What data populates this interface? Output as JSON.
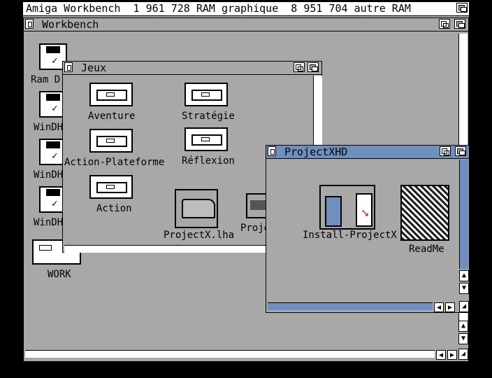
{
  "screen": {
    "title": "Amiga Workbench  1 961 728 RAM graphique  8 951 704 autre RAM"
  },
  "workbench_window": {
    "title": "Workbench",
    "icons": [
      {
        "label": "Ram D"
      },
      {
        "label": "WinDH"
      },
      {
        "label": "WinDH"
      },
      {
        "label": "WinDH"
      },
      {
        "label": "WORK"
      }
    ]
  },
  "jeux_window": {
    "title": "Jeux",
    "icons": [
      {
        "label": "Aventure"
      },
      {
        "label": "Stratégie"
      },
      {
        "label": "Action-Plateforme"
      },
      {
        "label": "Réflexion"
      },
      {
        "label": "Action"
      },
      {
        "label": "ProjectX.lha"
      },
      {
        "label": "Proje"
      }
    ]
  },
  "projectxhd_window": {
    "title": "ProjectXHD",
    "icons": [
      {
        "label": "Install-ProjectX"
      },
      {
        "label": "ReadMe"
      }
    ]
  },
  "colors": {
    "desktop": "#a8a8a8",
    "active_title": "#6f8fbf",
    "border": "#000000",
    "highlight": "#ffffff"
  }
}
